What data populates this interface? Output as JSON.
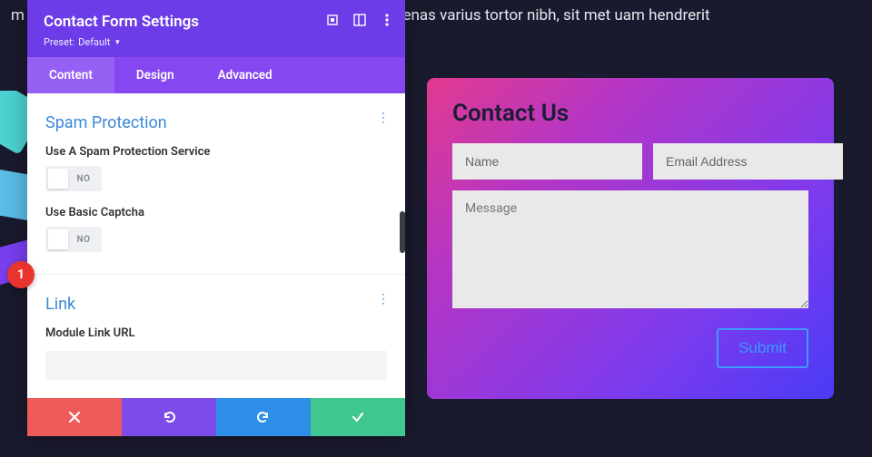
{
  "bgtext": "m ipsum dolor sit amet, consectetur adipiscing elit. Maecenas varius tortor nibh, sit met                                                                                                     uam hendrerit",
  "badge": "1",
  "panel": {
    "title": "Contact Form Settings",
    "preset_label": "Preset:",
    "preset_value": "Default",
    "tabs": {
      "content": "Content",
      "design": "Design",
      "advanced": "Advanced"
    },
    "sections": {
      "spam": {
        "title": "Spam Protection",
        "opt1_label": "Use A Spam Protection Service",
        "opt2_label": "Use Basic Captcha",
        "toggle_off": "NO"
      },
      "link": {
        "title": "Link",
        "url_label": "Module Link URL"
      }
    }
  },
  "contact": {
    "title": "Contact Us",
    "name_ph": "Name",
    "email_ph": "Email Address",
    "msg_ph": "Message",
    "submit": "Submit"
  }
}
